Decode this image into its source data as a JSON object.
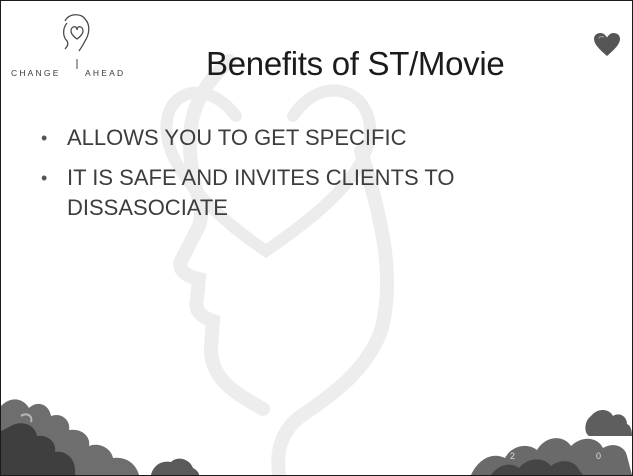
{
  "logo": {
    "left_text": "CHANGE",
    "right_text": "AHEAD",
    "icon": "head-with-heart-icon"
  },
  "title": "Benefits of ST/Movie",
  "bullets": [
    "ALLOWS YOU TO GET SPECIFIC",
    "IT IS SAFE AND INVITES CLIENTS TO DISSASOCIATE"
  ],
  "decorations": {
    "corner_icon": "heart-icon",
    "watermark": "head-with-heart-watermark",
    "bottom_art": "soft-cloud-clusters"
  },
  "page_number": {
    "left": "2",
    "right": "0"
  },
  "colors": {
    "title": "#1b1b1b",
    "body_text": "#3d3d3d",
    "watermark": "#ededed",
    "heart": "#555555"
  }
}
